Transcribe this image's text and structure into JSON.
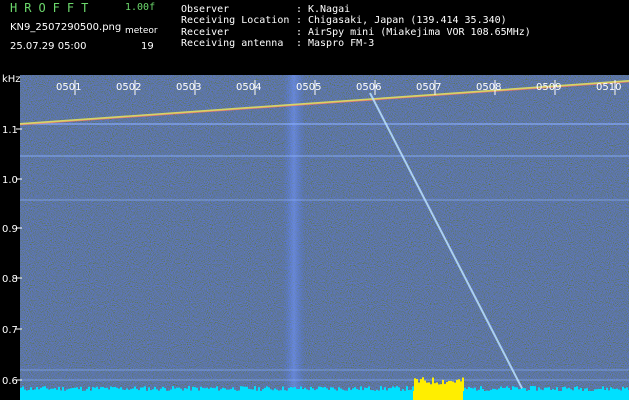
{
  "header": {
    "app_title": "HROFFT",
    "version": "1.00f",
    "file_name": "KN9_2507290500.png",
    "mode_label": "meteor",
    "timestamp": "25.07.29 05:00",
    "count": "19",
    "info": [
      {
        "key": "Observer",
        "value": "K.Nagai"
      },
      {
        "key": "Receiving Location",
        "value": "Chigasaki, Japan (139.414 35.340)"
      },
      {
        "key": "Receiver",
        "value": "AirSpy mini (Miakejima VOR 108.65MHz)"
      },
      {
        "key": "Receiving antenna",
        "value": "Maspro FM-3"
      }
    ]
  },
  "spectrogram": {
    "y_unit": "kHz",
    "y_ticks": [
      "1.1",
      "1.0",
      "0.9",
      "0.8",
      "0.7",
      "0.6"
    ],
    "time_ticks": [
      "0501",
      "0502",
      "0503",
      "0504",
      "0505",
      "0506",
      "0507",
      "0508",
      "0509",
      "0510"
    ],
    "colors": {
      "background": "#0a0a5a",
      "grid": "#8ab0ff",
      "trace": "#e0e060",
      "baseline": "#00e0ff",
      "burst": "#ffee00"
    }
  }
}
